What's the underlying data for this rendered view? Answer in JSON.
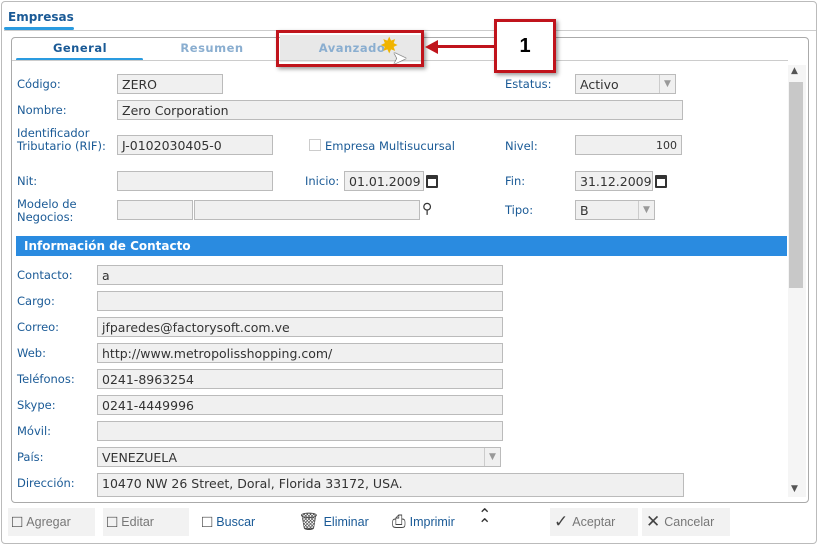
{
  "window": {
    "tab": "Empresas"
  },
  "subtabs": [
    "General",
    "Resumen",
    "Avanzado"
  ],
  "form": {
    "codigo": {
      "label": "Código:",
      "value": "ZERO"
    },
    "estatus": {
      "label": "Estatus:",
      "value": "Activo"
    },
    "nombre": {
      "label": "Nombre:",
      "value": "Zero Corporation"
    },
    "rif": {
      "label": "Identificador Tributario (RIF):",
      "value": "J-0102030405-0"
    },
    "multisucursal": {
      "label": "Empresa Multisucursal",
      "checked": false
    },
    "nivel": {
      "label": "Nivel:",
      "value": "100"
    },
    "nit": {
      "label": "Nit:",
      "value": ""
    },
    "inicio": {
      "label": "Inicio:",
      "value": "01.01.2009"
    },
    "fin": {
      "label": "Fin:",
      "value": "31.12.2009"
    },
    "modelo": {
      "label": "Modelo de Negocios:",
      "code": "",
      "name": ""
    },
    "tipo": {
      "label": "Tipo:",
      "value": "B"
    }
  },
  "contact": {
    "title": "Información de Contacto",
    "fields": [
      {
        "label": "Contacto:",
        "value": "a"
      },
      {
        "label": "Cargo:",
        "value": ""
      },
      {
        "label": "Correo:",
        "value": "jfparedes@factorysoft.com.ve"
      },
      {
        "label": "Web:",
        "value": "http://www.metropolisshopping.com/"
      },
      {
        "label": "Teléfonos:",
        "value": "0241-8963254"
      },
      {
        "label": "Skype:",
        "value": "0241-4449996"
      },
      {
        "label": "Móvil:",
        "value": ""
      },
      {
        "label": "País:",
        "value": "VENEZUELA"
      },
      {
        "label": "Dirección:",
        "value": "10470 NW 26 Street, Doral, Florida 33172, USA."
      }
    ]
  },
  "toolbar": {
    "agregar": "Agregar",
    "editar": "Editar",
    "buscar": "Buscar",
    "eliminar": "Eliminar",
    "imprimir": "Imprimir",
    "aceptar": "Aceptar",
    "cancelar": "Cancelar"
  },
  "annotation": {
    "number": "1",
    "color": "#c0141c"
  },
  "colors": {
    "accent": "#2a8be0",
    "label": "#1a5a96"
  }
}
